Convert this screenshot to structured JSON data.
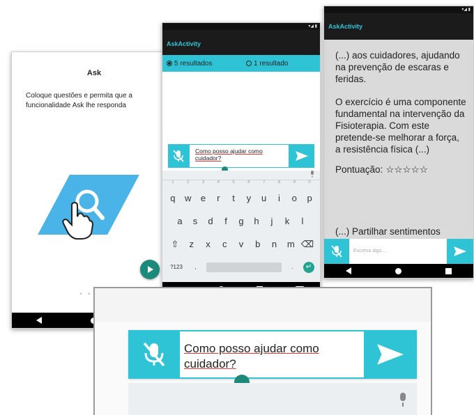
{
  "onboarding": {
    "title": "Ask",
    "description": "Coloque questões e permita que a funcionalidade Ask lhe responda",
    "page_dots": "• • • •",
    "accent": "#2ec4d6"
  },
  "middle": {
    "app_title": "AskActivity",
    "radio_options": [
      {
        "label": "5 resultados",
        "selected": true
      },
      {
        "label": "1 resultado",
        "selected": false
      }
    ],
    "input_text": "Como posso ajudar como cuidador?",
    "keyboard": {
      "numbers": [
        "1",
        "2",
        "3",
        "4",
        "5",
        "6",
        "7",
        "8",
        "9",
        "0"
      ],
      "row1": [
        "q",
        "w",
        "e",
        "r",
        "t",
        "y",
        "u",
        "i",
        "o",
        "p"
      ],
      "row2": [
        "a",
        "s",
        "d",
        "f",
        "g",
        "h",
        "j",
        "k",
        "l"
      ],
      "row3": [
        "z",
        "x",
        "c",
        "v",
        "b",
        "n",
        "m"
      ],
      "sym_label": "?123",
      "comma": ",",
      "period": "."
    }
  },
  "right": {
    "app_title": "AskActivity",
    "paragraph1": "(...) aos cuidadores, ajudando na prevenção de escaras e feridas.",
    "paragraph2": "O exercício é uma componente fundamental na intervenção da Fisioterapia. Com este pretende-se melhorar a força, a resistência física (...)",
    "rating_label": "Pontuação:",
    "rating_stars": "☆☆☆☆☆",
    "next_result": "(...) Partilhar sentimentos",
    "input_placeholder": "Escreva algo..."
  },
  "zoom": {
    "input_text": "Como posso ajudar como cuidador?"
  }
}
